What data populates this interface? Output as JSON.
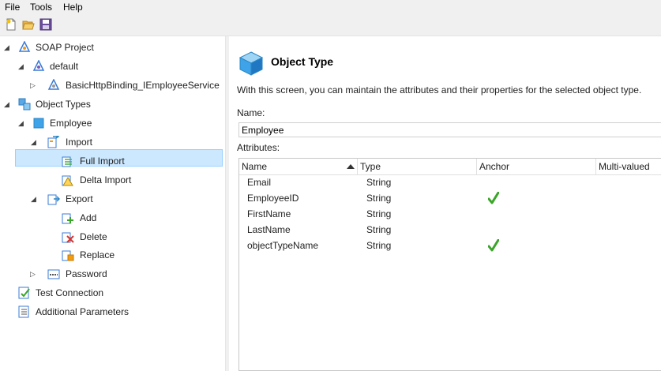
{
  "menu": {
    "file": "File",
    "tools": "Tools",
    "help": "Help"
  },
  "toolbar": {
    "new_icon": "new-icon",
    "open_icon": "open-folder-icon",
    "save_icon": "save-icon"
  },
  "tree": {
    "soap_project": "SOAP Project",
    "default": "default",
    "binding": "BasicHttpBinding_IEmployeeService",
    "object_types": "Object Types",
    "employee": "Employee",
    "import": "Import",
    "full_import": "Full Import",
    "delta_import": "Delta Import",
    "export": "Export",
    "add": "Add",
    "delete": "Delete",
    "replace": "Replace",
    "password": "Password",
    "test_connection": "Test Connection",
    "additional_parameters": "Additional Parameters"
  },
  "content": {
    "title": "Object Type",
    "description": "With this screen, you can maintain the attributes and their properties for the selected object type.",
    "name_label": "Name:",
    "name_value": "Employee",
    "attributes_label": "Attributes:"
  },
  "grid": {
    "columns": [
      "Name",
      "Type",
      "Anchor",
      "Multi-valued"
    ],
    "rows": [
      {
        "name": "Email",
        "type": "String",
        "anchor": false
      },
      {
        "name": "EmployeeID",
        "type": "String",
        "anchor": true
      },
      {
        "name": "FirstName",
        "type": "String",
        "anchor": false
      },
      {
        "name": "LastName",
        "type": "String",
        "anchor": false
      },
      {
        "name": "objectTypeName",
        "type": "String",
        "anchor": true
      }
    ]
  },
  "colors": {
    "selection": "#cce8ff",
    "selection_border": "#99d1ff",
    "check": "#3aa629"
  }
}
